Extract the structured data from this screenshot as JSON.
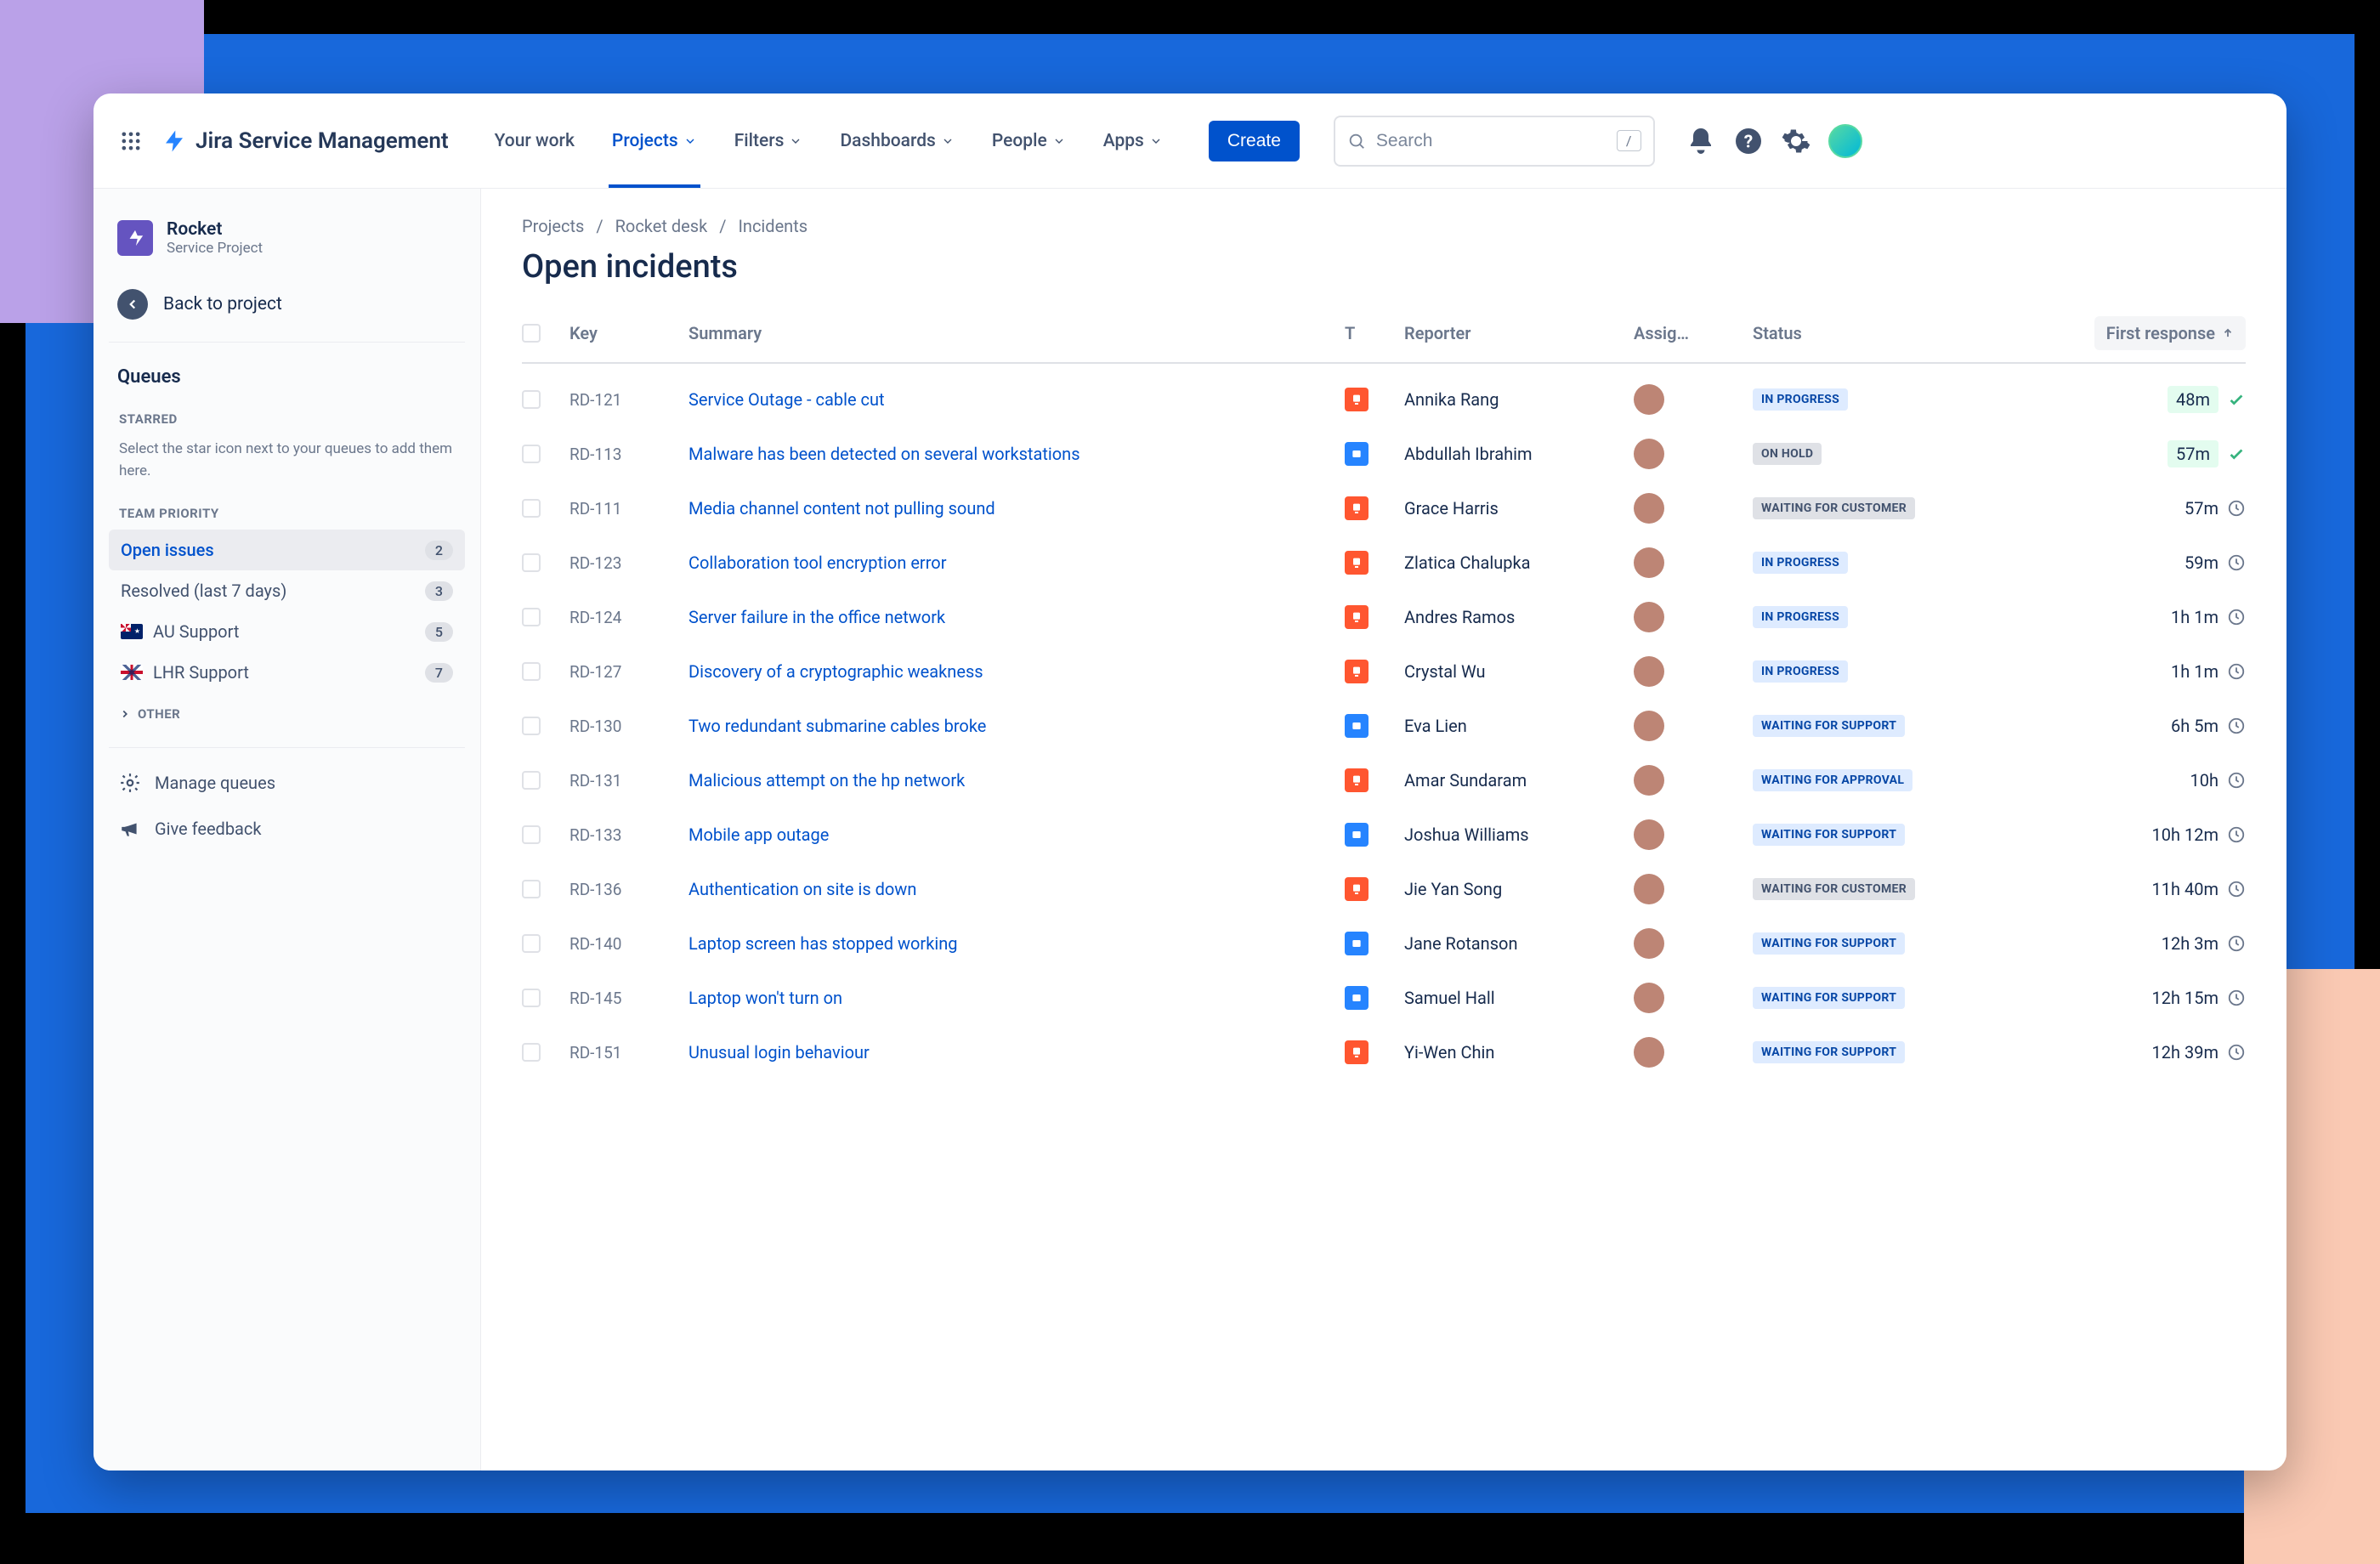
{
  "app": {
    "name": "Jira Service Management"
  },
  "topnav": {
    "items": [
      {
        "label": "Your work",
        "dropdown": false,
        "active": false
      },
      {
        "label": "Projects",
        "dropdown": true,
        "active": true
      },
      {
        "label": "Filters",
        "dropdown": true,
        "active": false
      },
      {
        "label": "Dashboards",
        "dropdown": true,
        "active": false
      },
      {
        "label": "People",
        "dropdown": true,
        "active": false
      },
      {
        "label": "Apps",
        "dropdown": true,
        "active": false
      }
    ],
    "create_label": "Create",
    "search_placeholder": "Search",
    "search_shortcut": "/"
  },
  "sidebar": {
    "project_name": "Rocket",
    "project_sub": "Service Project",
    "back_label": "Back to project",
    "queues_title": "Queues",
    "starred_heading": "STARRED",
    "starred_hint": "Select the star icon next to your queues to add them here.",
    "team_priority_heading": "TEAM PRIORITY",
    "queues": [
      {
        "label": "Open issues",
        "count": "2",
        "active": true,
        "flag": null
      },
      {
        "label": "Resolved (last 7 days)",
        "count": "3",
        "active": false,
        "flag": null
      },
      {
        "label": "AU Support",
        "count": "5",
        "active": false,
        "flag": "au"
      },
      {
        "label": "LHR Support",
        "count": "7",
        "active": false,
        "flag": "uk"
      }
    ],
    "other_heading": "OTHER",
    "manage_label": "Manage queues",
    "feedback_label": "Give feedback"
  },
  "breadcrumbs": [
    "Projects",
    "Rocket desk",
    "Incidents"
  ],
  "page_title": "Open incidents",
  "columns": {
    "key": "Key",
    "summary": "Summary",
    "type": "T",
    "reporter": "Reporter",
    "assignee": "Assig…",
    "status": "Status",
    "first_response": "First response"
  },
  "status_labels": {
    "progress": "IN PROGRESS",
    "hold": "ON HOLD",
    "waiting_customer": "WAITING FOR CUSTOMER",
    "waiting_support": "WAITING FOR SUPPORT",
    "waiting_approval": "WAITING FOR APPROVAL"
  },
  "rows": [
    {
      "key": "RD-121",
      "summary": "Service Outage - cable cut",
      "type": "orange",
      "reporter": "Annika Rang",
      "status": "progress",
      "response": "48m",
      "resp_state": "ok"
    },
    {
      "key": "RD-113",
      "summary": "Malware has been detected on several workstations",
      "type": "blue",
      "reporter": "Abdullah Ibrahim",
      "status": "hold",
      "response": "57m",
      "resp_state": "ok"
    },
    {
      "key": "RD-111",
      "summary": "Media channel content not pulling sound",
      "type": "orange",
      "reporter": "Grace Harris",
      "status": "waiting_customer",
      "response": "57m",
      "resp_state": "clock"
    },
    {
      "key": "RD-123",
      "summary": "Collaboration tool encryption error",
      "type": "orange",
      "reporter": "Zlatica Chalupka",
      "status": "progress",
      "response": "59m",
      "resp_state": "clock"
    },
    {
      "key": "RD-124",
      "summary": "Server failure in the office network",
      "type": "orange",
      "reporter": "Andres Ramos",
      "status": "progress",
      "response": "1h 1m",
      "resp_state": "clock"
    },
    {
      "key": "RD-127",
      "summary": "Discovery of a cryptographic weakness",
      "type": "orange",
      "reporter": "Crystal Wu",
      "status": "progress",
      "response": "1h 1m",
      "resp_state": "clock"
    },
    {
      "key": "RD-130",
      "summary": "Two redundant submarine cables broke",
      "type": "blue",
      "reporter": "Eva Lien",
      "status": "waiting_support",
      "response": "6h 5m",
      "resp_state": "clock"
    },
    {
      "key": "RD-131",
      "summary": "Malicious attempt on the hp network",
      "type": "orange",
      "reporter": "Amar Sundaram",
      "status": "waiting_approval",
      "response": "10h",
      "resp_state": "clock"
    },
    {
      "key": "RD-133",
      "summary": "Mobile app outage",
      "type": "blue",
      "reporter": "Joshua Williams",
      "status": "waiting_support",
      "response": "10h 12m",
      "resp_state": "clock"
    },
    {
      "key": "RD-136",
      "summary": "Authentication on site is down",
      "type": "orange",
      "reporter": "Jie Yan Song",
      "status": "waiting_customer",
      "response": "11h 40m",
      "resp_state": "clock"
    },
    {
      "key": "RD-140",
      "summary": "Laptop screen has stopped working",
      "type": "blue",
      "reporter": "Jane Rotanson",
      "status": "waiting_support",
      "response": "12h 3m",
      "resp_state": "clock"
    },
    {
      "key": "RD-145",
      "summary": "Laptop won't turn on",
      "type": "blue",
      "reporter": "Samuel Hall",
      "status": "waiting_support",
      "response": "12h 15m",
      "resp_state": "clock"
    },
    {
      "key": "RD-151",
      "summary": "Unusual login behaviour",
      "type": "orange",
      "reporter": "Yi-Wen Chin",
      "status": "waiting_support",
      "response": "12h 39m",
      "resp_state": "clock"
    }
  ]
}
